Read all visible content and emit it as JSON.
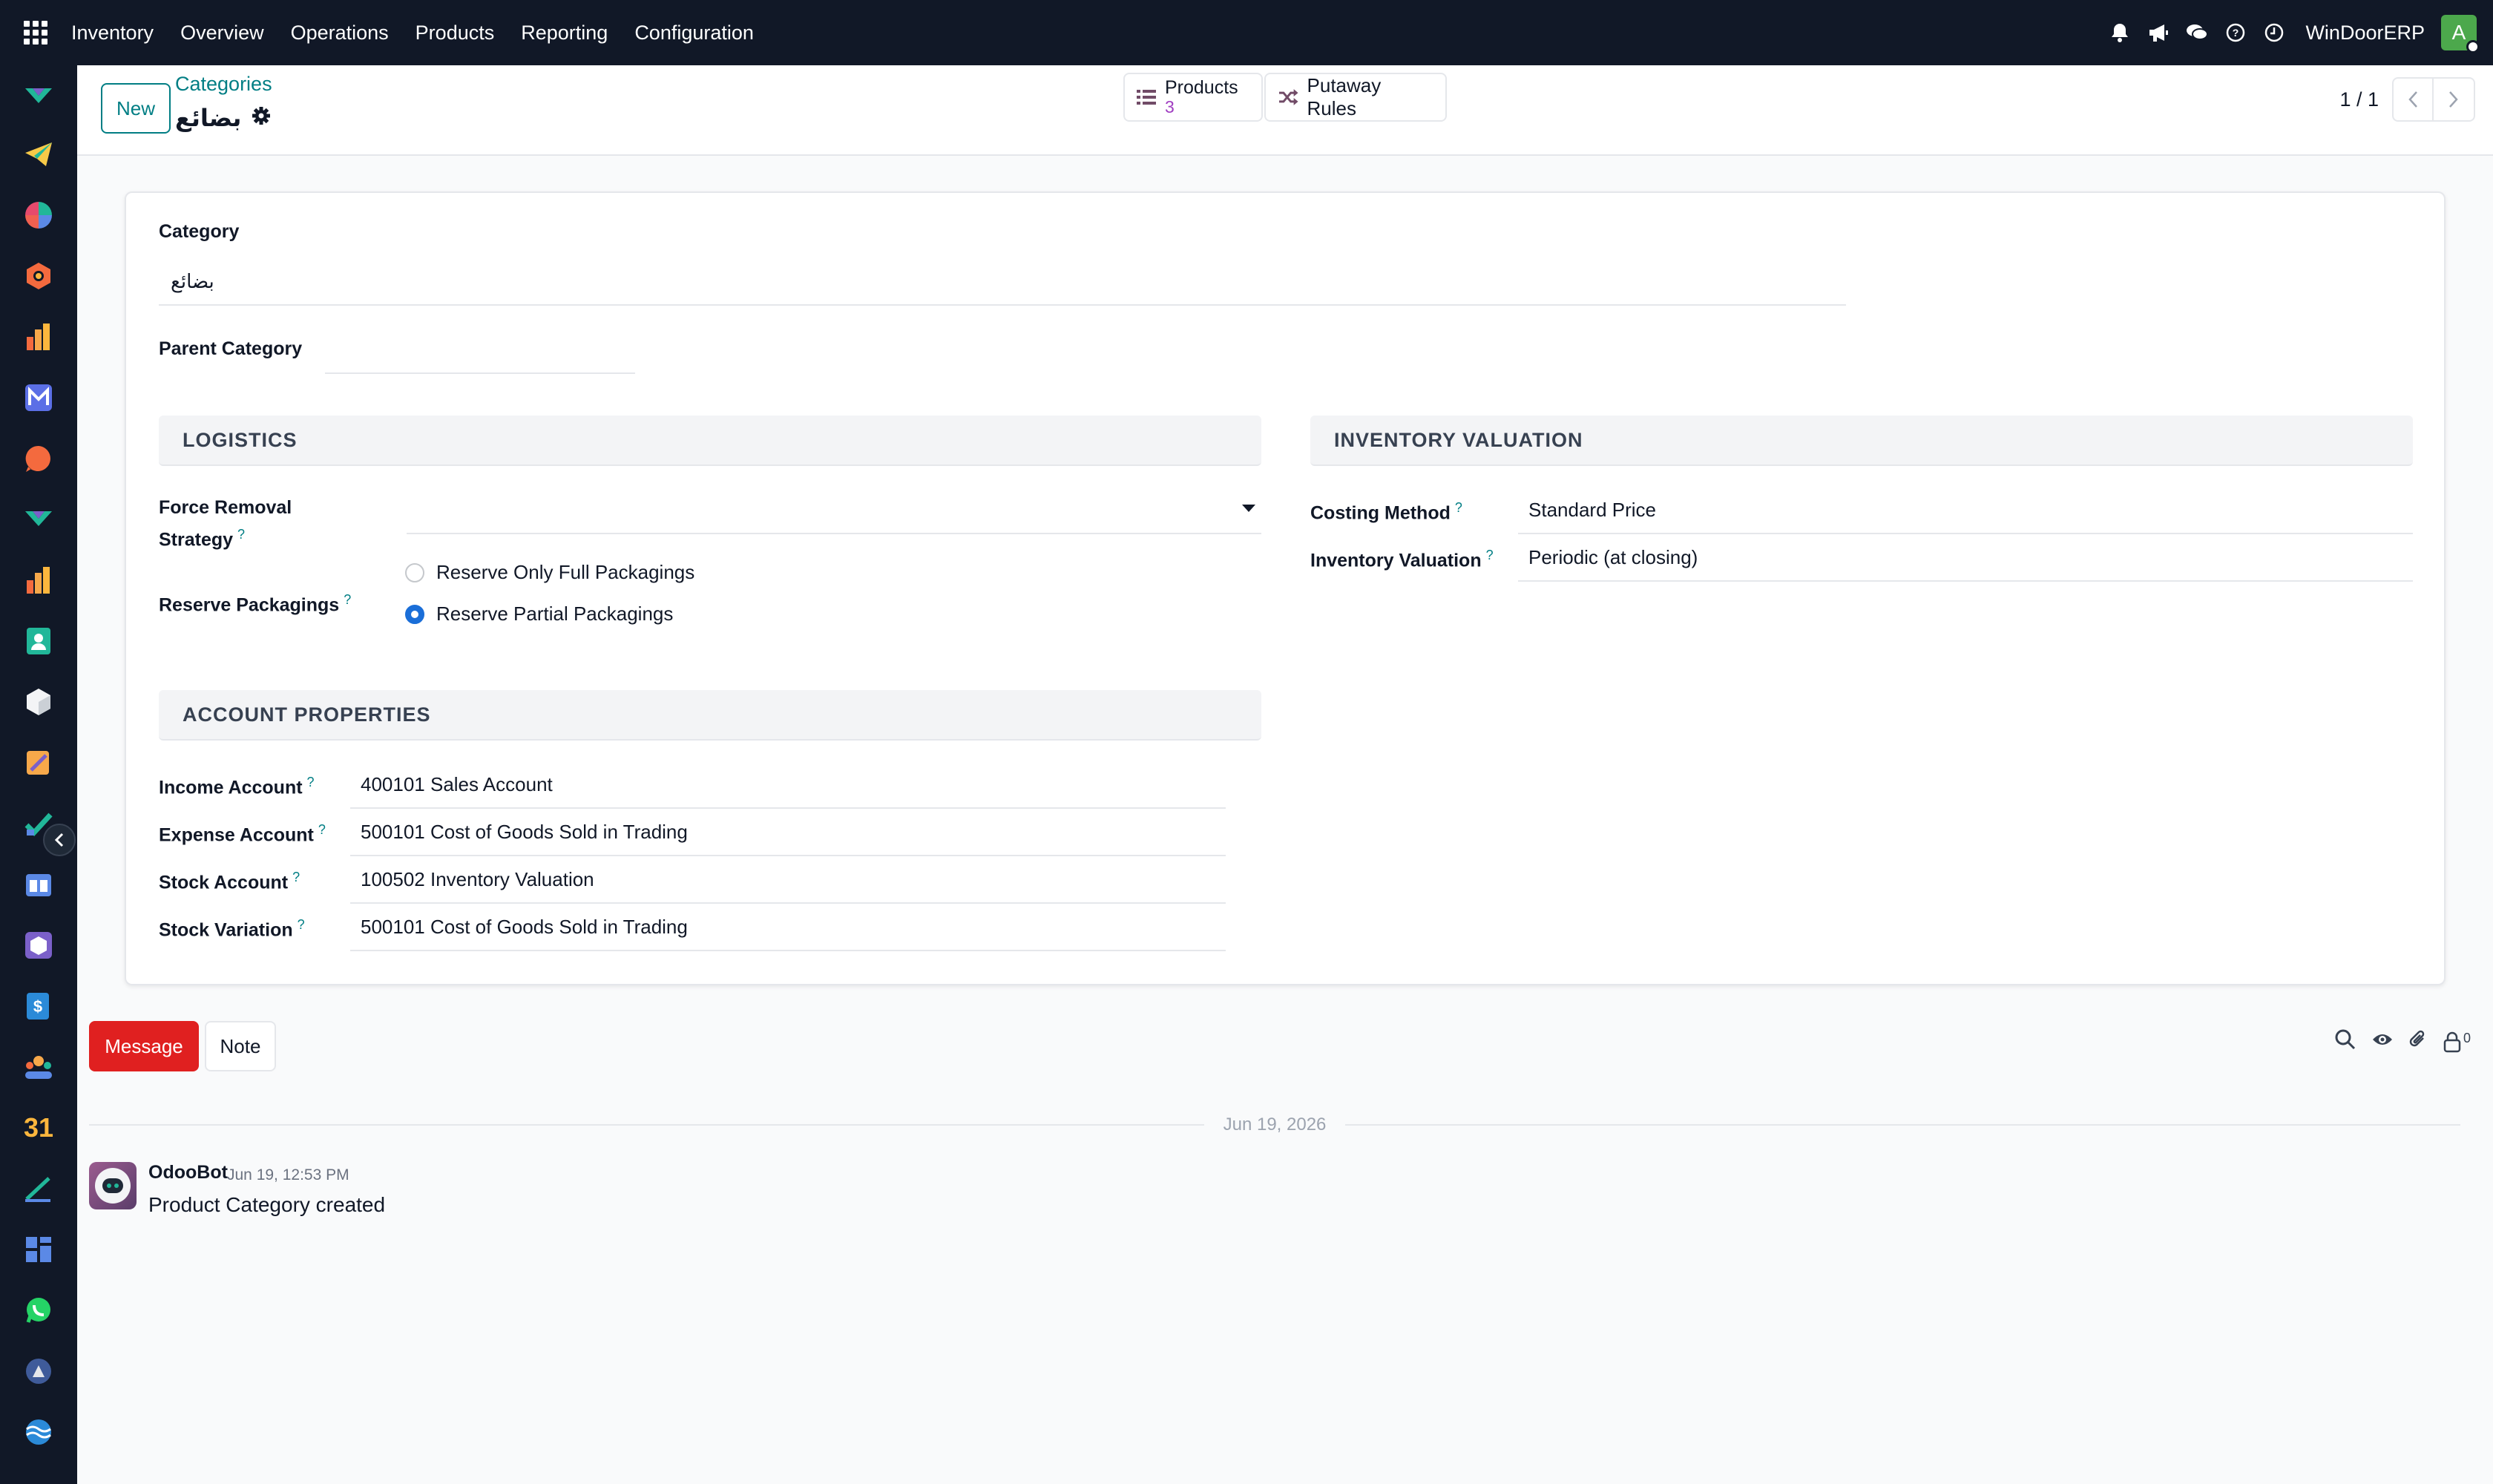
{
  "navbar": {
    "app_name": "Inventory",
    "menu": [
      "Overview",
      "Operations",
      "Products",
      "Reporting",
      "Configuration"
    ],
    "company": "WinDoorERP",
    "avatar_letter": "A",
    "icons": [
      "bell-icon",
      "megaphone-icon",
      "chat-icon",
      "help-icon",
      "clock-icon"
    ]
  },
  "sidebar": {
    "apps": [
      "discuss-app-icon",
      "telegram-app-icon",
      "pie-chart-app-icon",
      "hexagon-app-icon",
      "bar-chart-app-icon",
      "mail-app-icon",
      "chat-bubble-app-icon",
      "discuss-2-app-icon",
      "reporting-app-icon",
      "contacts-app-icon",
      "inventory-app-icon",
      "magic-app-icon",
      "check-app-icon",
      "books-app-icon",
      "cube-app-icon",
      "dollar-app-icon",
      "team-app-icon",
      "calendar-app-icon",
      "sign-app-icon",
      "dashboard-app-icon",
      "whatsapp-app-icon",
      "compass-app-icon",
      "wave-app-icon"
    ],
    "calendar_number": "31"
  },
  "control_panel": {
    "new_label": "New",
    "breadcrumb": "Categories",
    "title": "بضائع",
    "smart_buttons": {
      "products_label": "Products",
      "products_count": "3",
      "putaway_label": "Putaway Rules"
    },
    "pager": "1 / 1"
  },
  "form": {
    "category_label": "Category",
    "category_value": "بضائع",
    "parent_label": "Parent Category",
    "parent_value": "",
    "logistics": {
      "title": "LOGISTICS",
      "removal_label_1": "Force Removal",
      "removal_label_2": "Strategy",
      "removal_value": "",
      "reserve_label": "Reserve Packagings",
      "reserve_options": [
        "Reserve Only Full Packagings",
        "Reserve Partial Packagings"
      ],
      "reserve_selected": 1
    },
    "valuation": {
      "title": "INVENTORY VALUATION",
      "costing_label": "Costing Method",
      "costing_value": "Standard Price",
      "valuation_label": "Inventory Valuation",
      "valuation_value": "Periodic (at closing)"
    },
    "accounts": {
      "title": "ACCOUNT PROPERTIES",
      "rows": [
        {
          "label": "Income Account",
          "value": "400101 Sales Account"
        },
        {
          "label": "Expense Account",
          "value": "500101 Cost of Goods Sold in Trading"
        },
        {
          "label": "Stock Account",
          "value": "100502 Inventory Valuation"
        },
        {
          "label": "Stock Variation",
          "value": "500101 Cost of Goods Sold in Trading"
        }
      ]
    },
    "help_mark": "?"
  },
  "chatter": {
    "message_label": "Message",
    "note_label": "Note",
    "followers_count": "0",
    "date_separator": "Jun 19, 2026",
    "messages": [
      {
        "author": "OdooBot",
        "time": "Jun 19, 12:53 PM",
        "body": "Product Category created"
      }
    ]
  },
  "colors": {
    "navbar_bg": "#111827",
    "link": "#017e84",
    "message_button": "#e02020",
    "radio_checked": "#1a6ed8",
    "avatar": "#4ca84c"
  }
}
